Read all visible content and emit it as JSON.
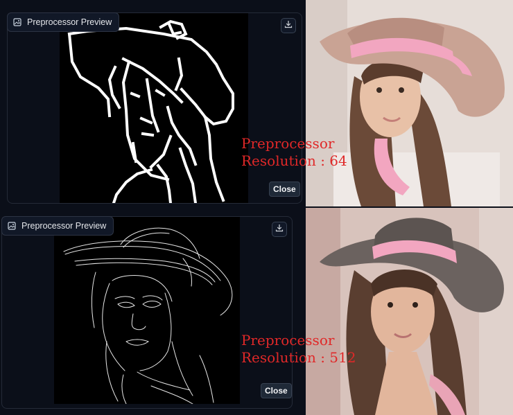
{
  "top_panel": {
    "title": "Preprocessor Preview",
    "close_label": "Close",
    "annotation_line1": "Preprocessor",
    "annotation_line2": "Resolution : 64"
  },
  "bottom_panel": {
    "title": "Preprocessor Preview",
    "close_label": "Close",
    "annotation_line1": "Preprocessor",
    "annotation_line2": "Resolution : 512"
  },
  "colors": {
    "panel_bg": "#0b0f19",
    "annotation": "#e02828",
    "hat_top": "#c9a394",
    "hat_bottom": "#6b625f",
    "ribbon": "#f2a6c0"
  },
  "icons": {
    "title_icon": "image-icon",
    "download_icon": "download-icon"
  }
}
